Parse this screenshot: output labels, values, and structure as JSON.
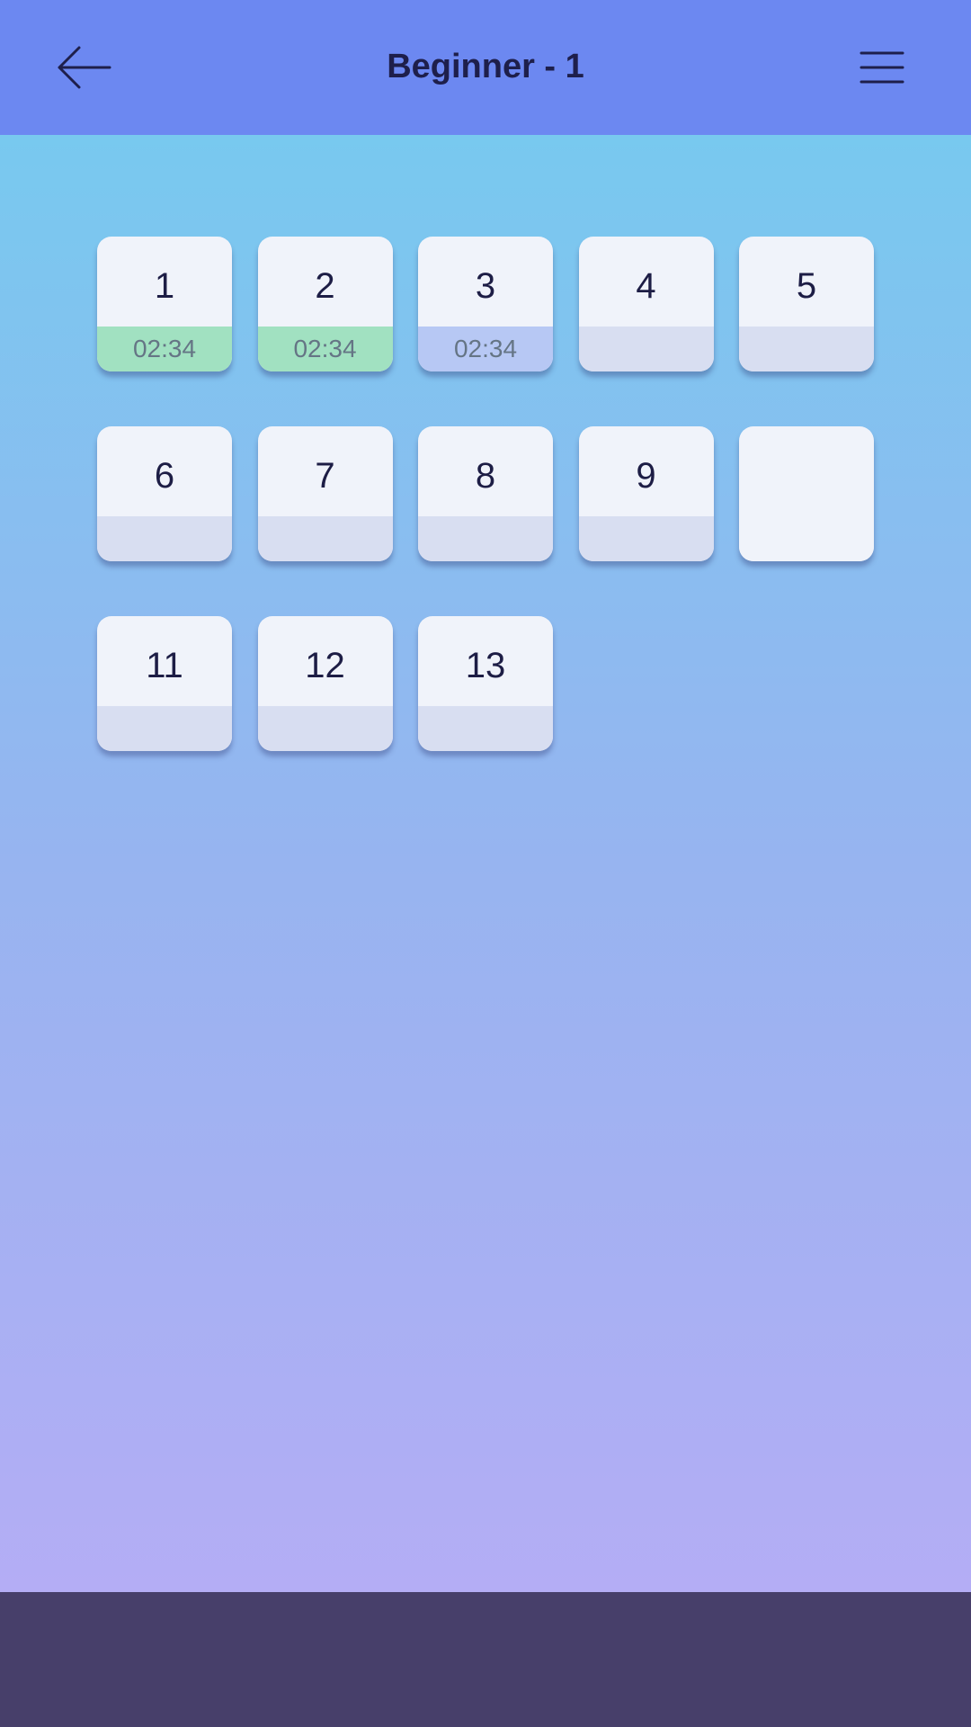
{
  "header": {
    "title": "Beginner - 1",
    "back_icon": "arrow-left-icon",
    "menu_icon": "hamburger-menu-icon",
    "background_color": "#6c88f1"
  },
  "levels": [
    {
      "number": "1",
      "time": "02:34",
      "status": "completed"
    },
    {
      "number": "2",
      "time": "02:34",
      "status": "completed"
    },
    {
      "number": "3",
      "time": "02:34",
      "status": "current"
    },
    {
      "number": "4",
      "time": "",
      "status": "locked"
    },
    {
      "number": "5",
      "time": "",
      "status": "locked"
    },
    {
      "number": "6",
      "time": "",
      "status": "locked"
    },
    {
      "number": "7",
      "time": "",
      "status": "locked"
    },
    {
      "number": "8",
      "time": "",
      "status": "locked"
    },
    {
      "number": "9",
      "time": "",
      "status": "locked"
    },
    {
      "number": "",
      "time": "",
      "status": "blank"
    },
    {
      "number": "11",
      "time": "",
      "status": "locked"
    },
    {
      "number": "12",
      "time": "",
      "status": "locked"
    },
    {
      "number": "13",
      "time": "",
      "status": "locked"
    }
  ],
  "colors": {
    "completed": "#a1e1c1",
    "current": "#b7c8f4",
    "locked": "#d8def1",
    "bottom_bar": "#473f6a"
  }
}
